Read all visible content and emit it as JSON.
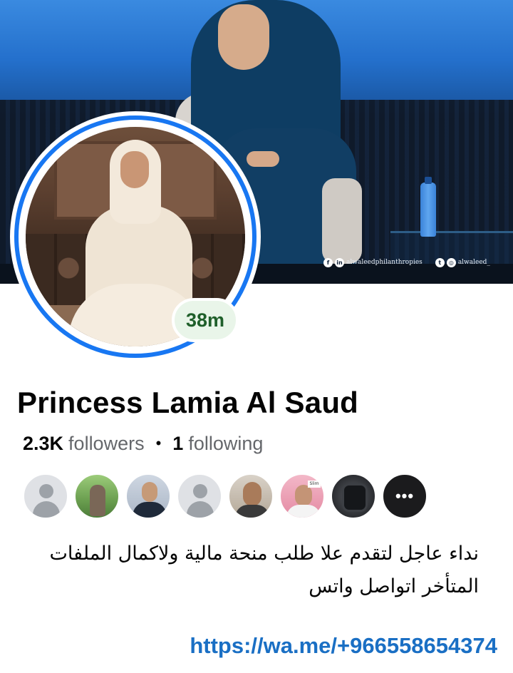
{
  "cover": {
    "social_handles": [
      {
        "icon": "facebook-icon",
        "glyph": "f",
        "icon2": "linkedin-icon",
        "glyph2": "in",
        "handle": "alwaleedphilanthropies"
      },
      {
        "icon": "twitter-icon",
        "glyph": "t",
        "icon2": "instagram-icon",
        "glyph2": "◎",
        "handle": "alwaleed_"
      }
    ]
  },
  "profile": {
    "badge": "38m",
    "name": "Princess Lamia Al Saud",
    "followers_count": "2.3K",
    "followers_label": "followers",
    "separator": "•",
    "following_count": "1",
    "following_label": "following",
    "more_glyph": "•••"
  },
  "bio": {
    "line1": "نداء عاجل لتقدم علا طلب منحة مالية ولاكمال الملفات",
    "line2": "المتأخر اتواصل واتس"
  },
  "link": {
    "text": "https://wa.me/+966558654374"
  },
  "friends_tag": "Slim",
  "colors": {
    "accent": "#1877f2",
    "link": "#1a6fc4",
    "badge_bg": "#e9f5e9",
    "badge_text": "#1f5f2a"
  }
}
